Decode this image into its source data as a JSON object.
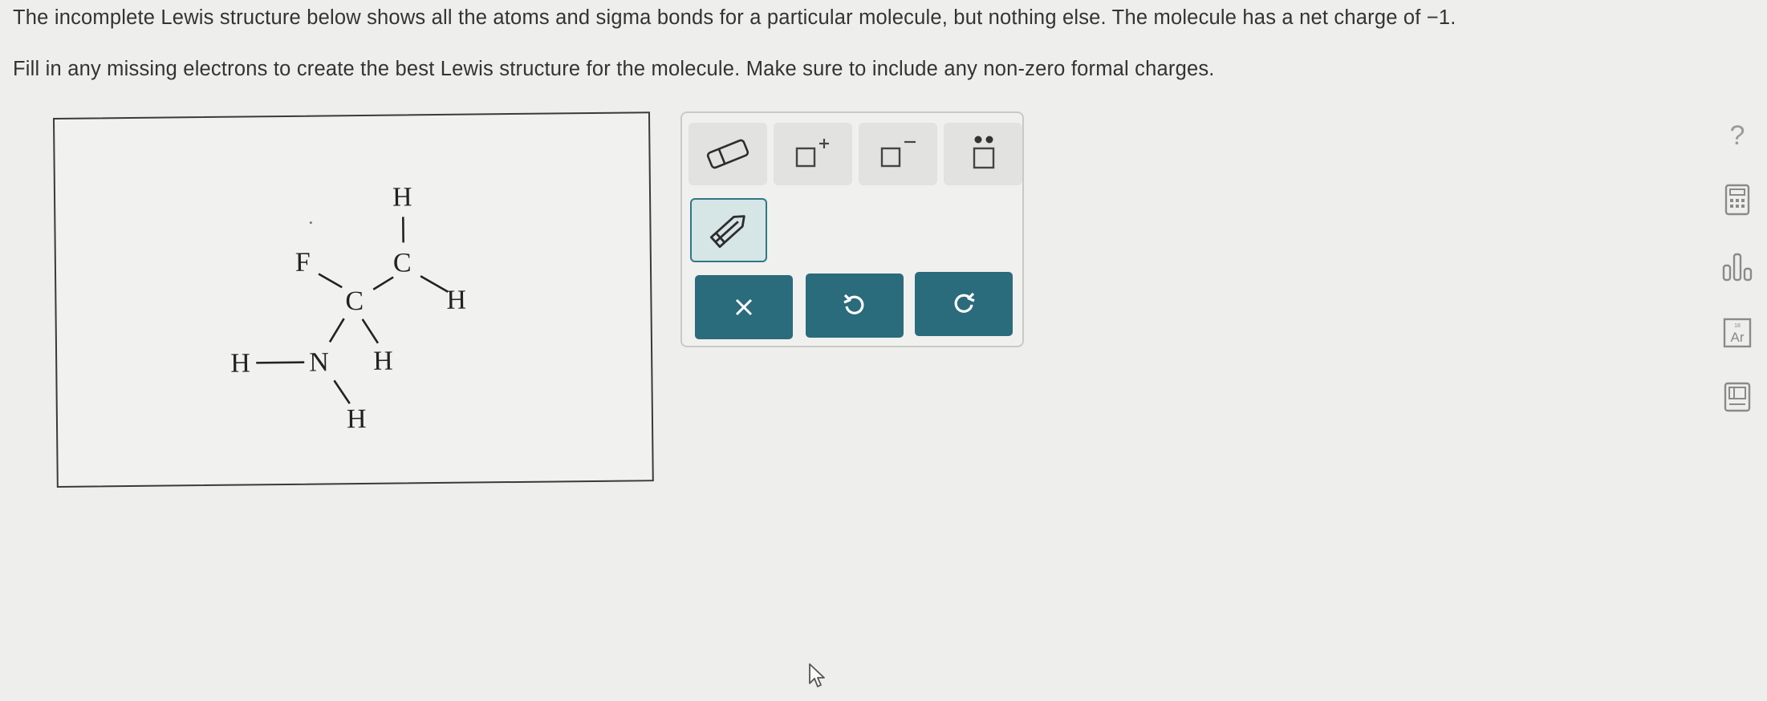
{
  "question": {
    "line1": "The incomplete Lewis structure below shows all the atoms and sigma bonds for a particular molecule, but nothing else. The molecule has a net charge of −1.",
    "line2": "Fill in any missing electrons to create the best Lewis structure for the molecule. Make sure to include any non-zero formal charges."
  },
  "molecule": {
    "atoms": {
      "F": "F",
      "C1": "C",
      "C2": "C",
      "N": "N",
      "H_top": "H",
      "H_right": "H",
      "H_c1": "H",
      "H_n_left": "H",
      "H_n_bottom": "H"
    }
  },
  "palette": {
    "tools": [
      {
        "name": "eraser-icon"
      },
      {
        "name": "positive-charge-icon"
      },
      {
        "name": "negative-charge-icon"
      },
      {
        "name": "lone-pair-icon"
      },
      {
        "name": "pencil-icon"
      }
    ],
    "actions": {
      "clear": "×",
      "undo": "↺",
      "redo": "↻"
    }
  },
  "sidebar": {
    "help": "?",
    "periodic_label": "Ar",
    "periodic_number": "18"
  },
  "colors": {
    "action_button": "#2a6b7c",
    "pencil_selected_bg": "#d6e5e6",
    "pencil_selected_border": "#2f7886",
    "background": "#eeeeec"
  }
}
